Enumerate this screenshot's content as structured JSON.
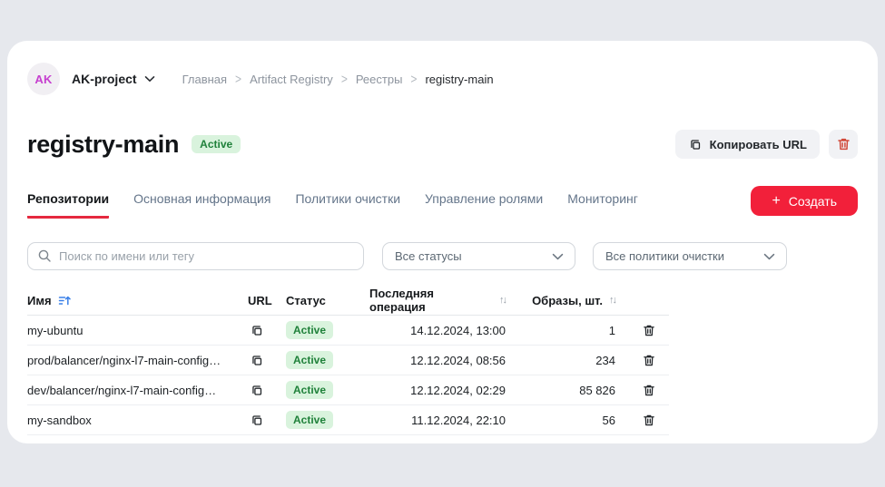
{
  "header": {
    "avatar_initials": "AK",
    "project_name": "AK-project",
    "breadcrumb_separator": ">",
    "breadcrumbs": [
      "Главная",
      "Artifact Registry",
      "Реестры",
      "registry-main"
    ]
  },
  "page": {
    "title": "registry-main",
    "status_badge": "Active",
    "copy_url_label": "Копировать URL"
  },
  "tabs": [
    {
      "label": "Репозитории",
      "active": true
    },
    {
      "label": "Основная информация",
      "active": false
    },
    {
      "label": "Политики очистки",
      "active": false
    },
    {
      "label": "Управление ролями",
      "active": false
    },
    {
      "label": "Мониторинг",
      "active": false
    }
  ],
  "create_button": {
    "icon": "+",
    "label": "Создать"
  },
  "filters": {
    "search_placeholder": "Поиск по имени или тегу",
    "status_filter_value": "Все статусы",
    "policy_filter_value": "Все политики очистки"
  },
  "table": {
    "columns": {
      "name": "Имя",
      "url": "URL",
      "status": "Статус",
      "last_operation": "Последняя операция",
      "images": "Образы, шт."
    },
    "sort_arrows": "↑↓",
    "rows": [
      {
        "name": "my-ubuntu",
        "status": "Active",
        "last_operation": "14.12.2024, 13:00",
        "images": "1"
      },
      {
        "name": "prod/balancer/nginx-l7-main-config…",
        "status": "Active",
        "last_operation": "12.12.2024, 08:56",
        "images": "234"
      },
      {
        "name": "dev/balancer/nginx-l7-main-config…",
        "status": "Active",
        "last_operation": "12.12.2024, 02:29",
        "images": "85 826"
      },
      {
        "name": "my-sandbox",
        "status": "Active",
        "last_operation": "11.12.2024, 22:10",
        "images": "56"
      }
    ]
  },
  "colors": {
    "page_background": "#e6e8ed",
    "card_background": "#ffffff",
    "accent_red": "#f2203a",
    "tab_underline_red": "#e5293f",
    "badge_background_green": "#d9f3dd",
    "badge_text_green": "#1f813a",
    "avatar_text_magenta": "#c640cf",
    "trash_icon_red": "#d14a3a",
    "sort_icon_blue": "#3a80e8",
    "inactive_tab_gray_blue": "#64758a"
  }
}
